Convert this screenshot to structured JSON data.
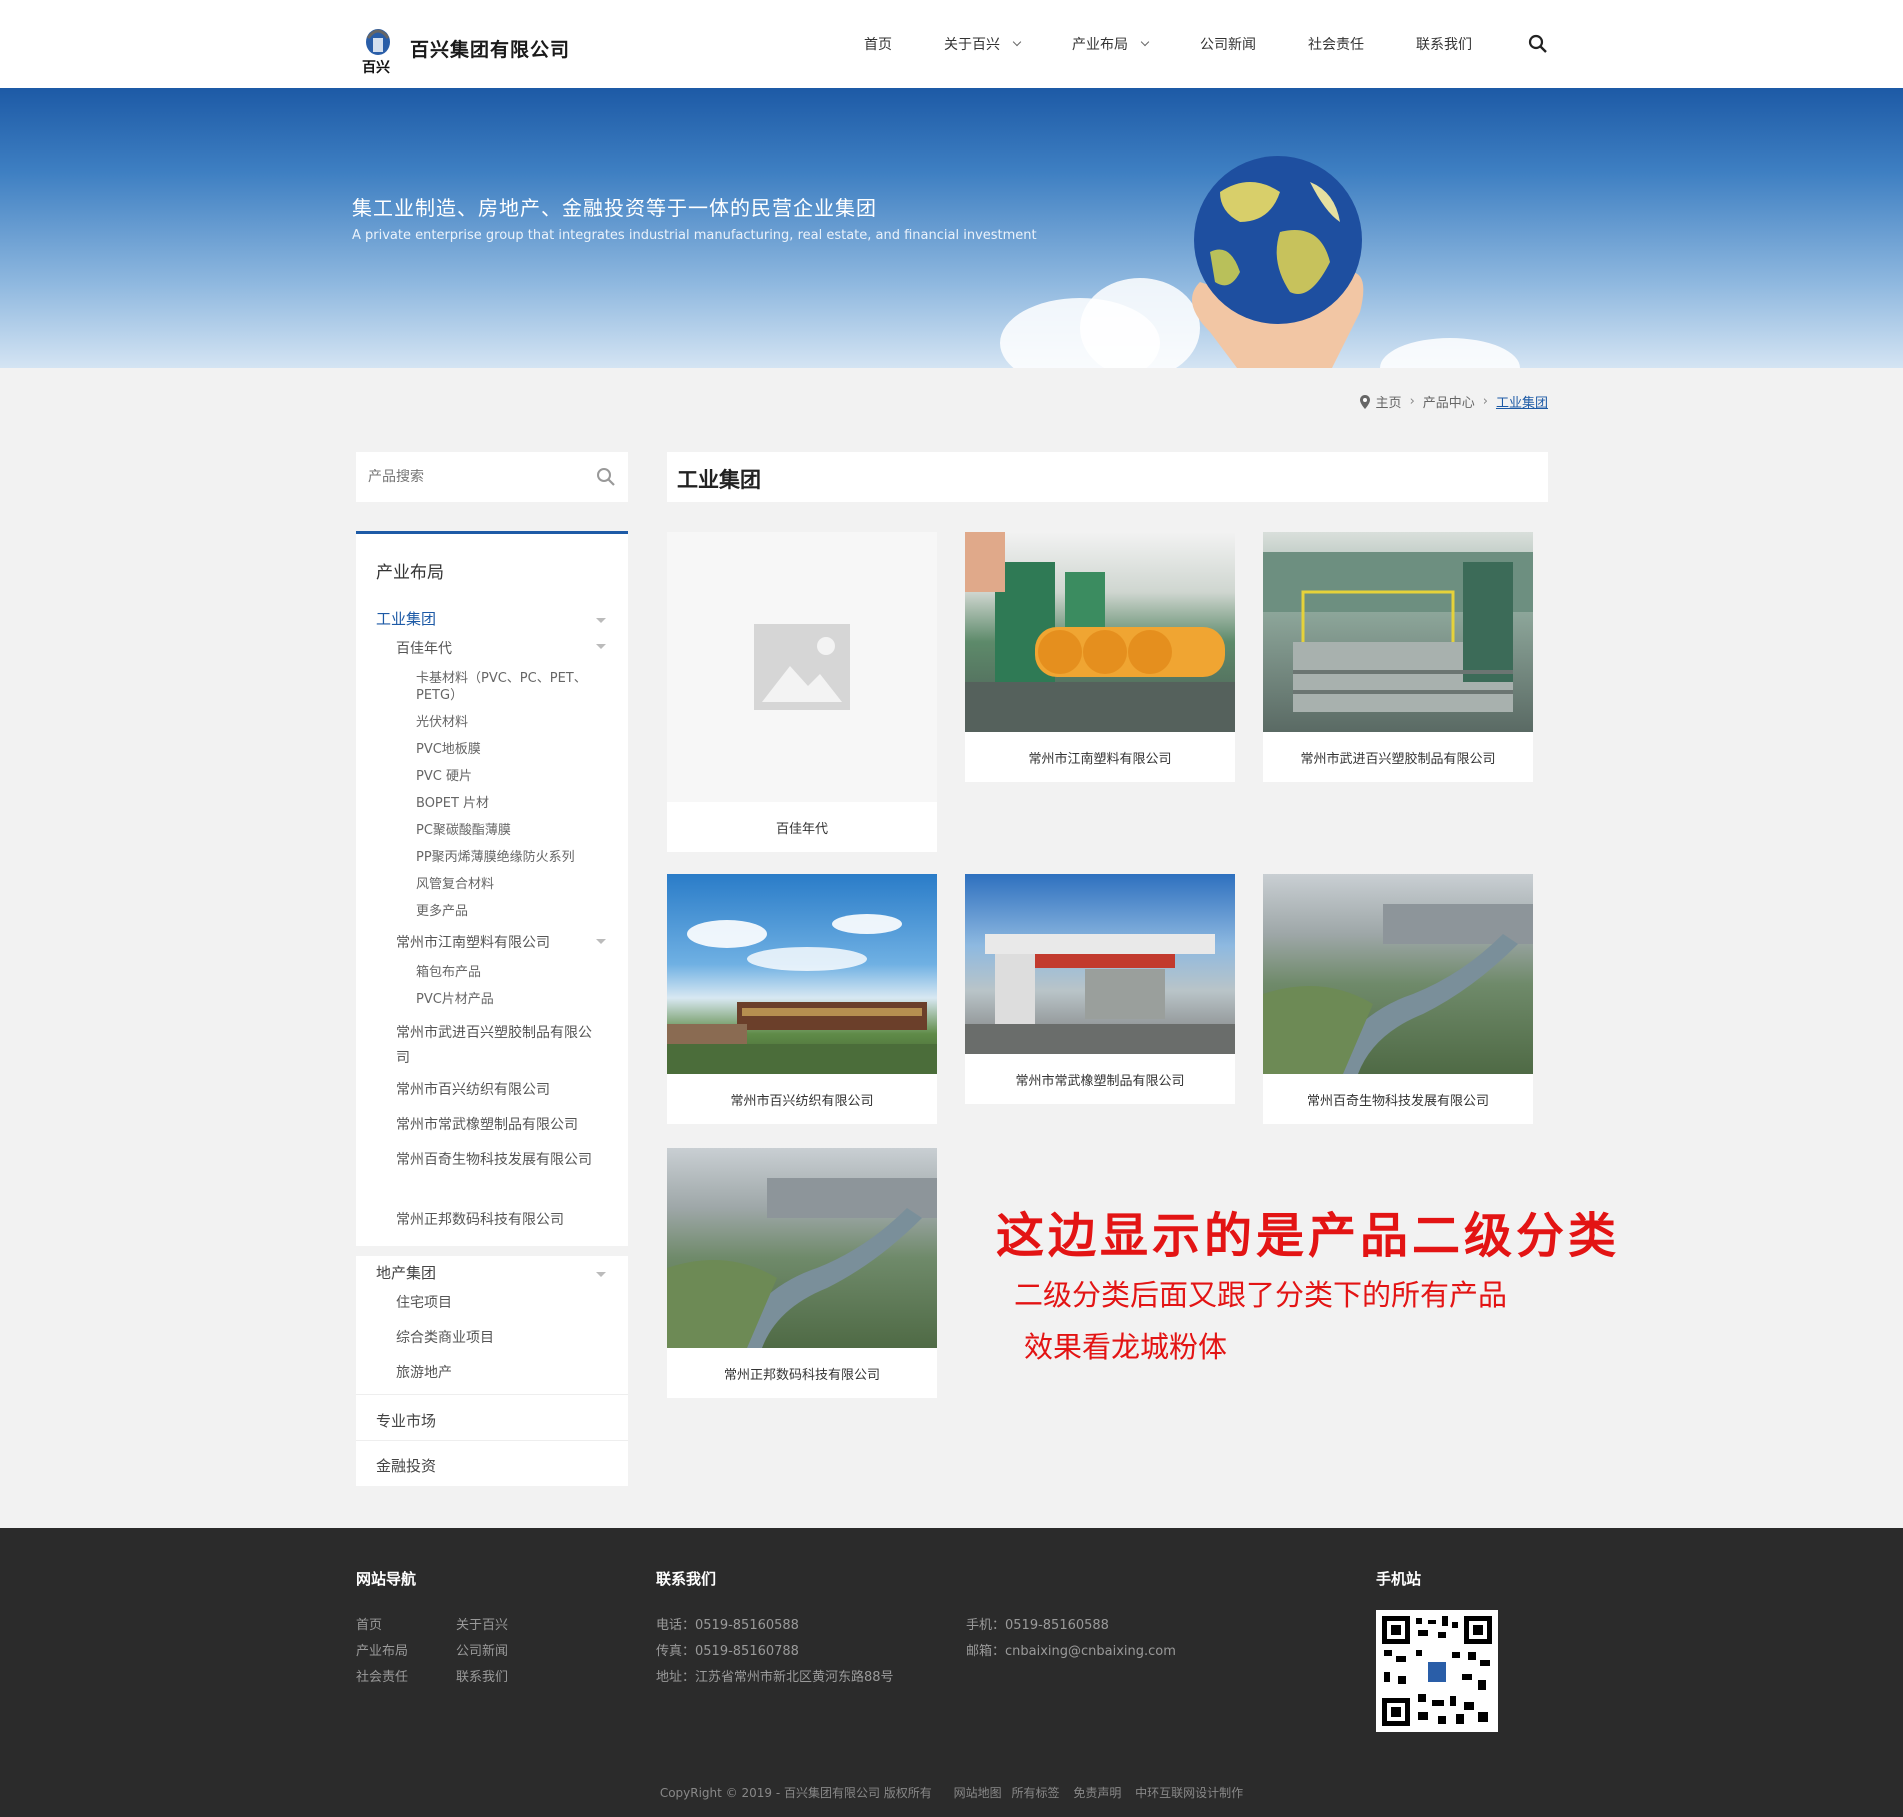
{
  "header": {
    "company_name": "百兴集团有限公司",
    "nav": [
      {
        "label": "首页"
      },
      {
        "label": "关于百兴"
      },
      {
        "label": "产业布局"
      },
      {
        "label": "公司新闻"
      },
      {
        "label": "社会责任"
      },
      {
        "label": "联系我们"
      }
    ],
    "search_icon": "search-icon"
  },
  "banner": {
    "title": "集工业制造、房地产、金融投资等于一体的民营企业集团",
    "subtitle": "A private enterprise group that integrates industrial manufacturing, real estate, and financial investment"
  },
  "breadcrumb": {
    "home": "主页",
    "level1": "产品中心",
    "current": "工业集团"
  },
  "sidebar": {
    "search_placeholder": "产品搜索",
    "title": "产业布局",
    "industrial": "工业集团",
    "baijia": "百佳年代",
    "baijia_items": [
      "卡基材料（PVC、PC、PET、PETG）",
      "光伏材料",
      "PVC地板膜",
      "PVC 硬片",
      "BOPET 片材",
      "PC聚碳酸酯薄膜",
      "PP聚丙烯薄膜绝缘防火系列",
      "风管复合材料",
      "更多产品"
    ],
    "jiangnan": "常州市江南塑料有限公司",
    "jiangnan_items": [
      "箱包布产品",
      "PVC片材产品"
    ],
    "companies": [
      "常州市武进百兴塑胶制品有限公司",
      "常州市百兴纺织有限公司",
      "常州市常武橡塑制品有限公司",
      "常州百奇生物科技发展有限公司",
      "常州正邦数码科技有限公司"
    ],
    "realestate": "地产集团",
    "realestate_items": [
      "住宅项目",
      "综合类商业项目",
      "旅游地产"
    ],
    "market": "专业市场",
    "finance": "金融投资"
  },
  "main": {
    "title": "工业集团",
    "cards": [
      {
        "caption": "百佳年代"
      },
      {
        "caption": "常州市江南塑料有限公司"
      },
      {
        "caption": "常州市武进百兴塑胶制品有限公司"
      },
      {
        "caption": "常州市百兴纺织有限公司"
      },
      {
        "caption": "常州市常武橡塑制品有限公司"
      },
      {
        "caption": "常州百奇生物科技发展有限公司"
      },
      {
        "caption": "常州正邦数码科技有限公司"
      }
    ],
    "overlay_line1": "这边显示的是产品二级分类",
    "overlay_line2": "二级分类后面又跟了分类下的所有产品",
    "overlay_line3": "效果看龙城粉体"
  },
  "footer": {
    "nav_title": "网站导航",
    "nav_links": [
      "首页",
      "关于百兴",
      "产业布局",
      "公司新闻",
      "社会责任",
      "联系我们"
    ],
    "contact_title": "联系我们",
    "phone": "电话：0519-85160588",
    "fax": "传真：0519-85160788",
    "address": "地址：江苏省常州市新北区黄河东路88号",
    "mobile": "手机：0519-85160588",
    "email": "邮箱：cnbaixing@cnbaixing.com",
    "mobile_site_title": "手机站",
    "copyright": "CopyRight © 2019 - 百兴集团有限公司 版权所有",
    "links": [
      "网站地图",
      "所有标签",
      "免责声明",
      "中环互联网设计制作"
    ]
  },
  "colors": {
    "brand_blue": "#1d5aa6",
    "footer_bg": "#2b2b2b",
    "overlay_red": "#e31414"
  }
}
